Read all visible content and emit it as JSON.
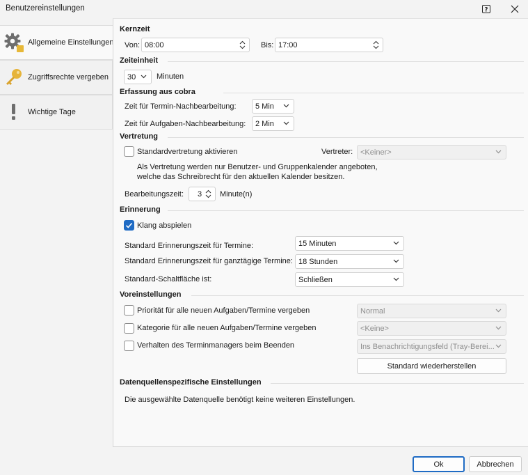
{
  "window": {
    "title": "Benutzereinstellungen"
  },
  "sidebar": {
    "items": [
      {
        "label": "Allgemeine Einstellungen",
        "icon": "gear-icon"
      },
      {
        "label": "Zugriffsrechte vergeben",
        "icon": "key-icon"
      },
      {
        "label": "Wichtige Tage",
        "icon": "exclamation-icon"
      }
    ]
  },
  "kernzeit": {
    "title": "Kernzeit",
    "von_label": "Von:",
    "von_value": "08:00",
    "bis_label": "Bis:",
    "bis_value": "17:00"
  },
  "zeiteinheit": {
    "title": "Zeiteinheit",
    "value": "30",
    "unit": "Minuten"
  },
  "erfassung": {
    "title": "Erfassung aus cobra",
    "termin_label": "Zeit für Termin-Nachbearbeitung:",
    "termin_value": "5 Min",
    "aufgaben_label": "Zeit für Aufgaben-Nachbearbeitung:",
    "aufgaben_value": "2 Min"
  },
  "vertretung": {
    "title": "Vertretung",
    "checkbox_label": "Standardvertretung aktivieren",
    "vertreter_label": "Vertreter:",
    "vertreter_value": "<Keiner>",
    "info_line1": "Als Vertretung werden nur Benutzer- und Gruppenkalender angeboten,",
    "info_line2": "welche das Schreibrecht für den aktuellen Kalender besitzen.",
    "bearbeitung_label": "Bearbeitungszeit:",
    "bearbeitung_value": "3",
    "bearbeitung_unit": "Minute(n)"
  },
  "erinnerung": {
    "title": "Erinnerung",
    "klang_label": "Klang abspielen",
    "klang_checked": true,
    "termine_label": "Standard Erinnerungszeit für Termine:",
    "termine_value": "15 Minuten",
    "ganztaegig_label": "Standard Erinnerungszeit für ganztägige Termine:",
    "ganztaegig_value": "18 Stunden",
    "schaltflaeche_label": "Standard-Schaltfläche ist:",
    "schaltflaeche_value": "Schließen"
  },
  "voreinstellungen": {
    "title": "Voreinstellungen",
    "prioritaet_label": "Priorität für alle neuen Aufgaben/Termine vergeben",
    "prioritaet_value": "Normal",
    "kategorie_label": "Kategorie für alle neuen Aufgaben/Termine vergeben",
    "kategorie_value": "<Keine>",
    "verhalten_label": "Verhalten des Terminmanagers beim Beenden",
    "verhalten_value": "Ins Benachrichtigungsfeld (Tray-Berei...",
    "reset_button": "Standard wiederherstellen"
  },
  "datenquelle": {
    "title": "Datenquellenspezifische Einstellungen",
    "text": "Die ausgewählte Datenquelle benötigt keine weiteren Einstellungen."
  },
  "footer": {
    "ok": "Ok",
    "cancel": "Abbrechen"
  },
  "colors": {
    "accent": "#1f6bc4",
    "panel_bg": "#f9f9f9",
    "window_bg": "#f3f3f3"
  }
}
